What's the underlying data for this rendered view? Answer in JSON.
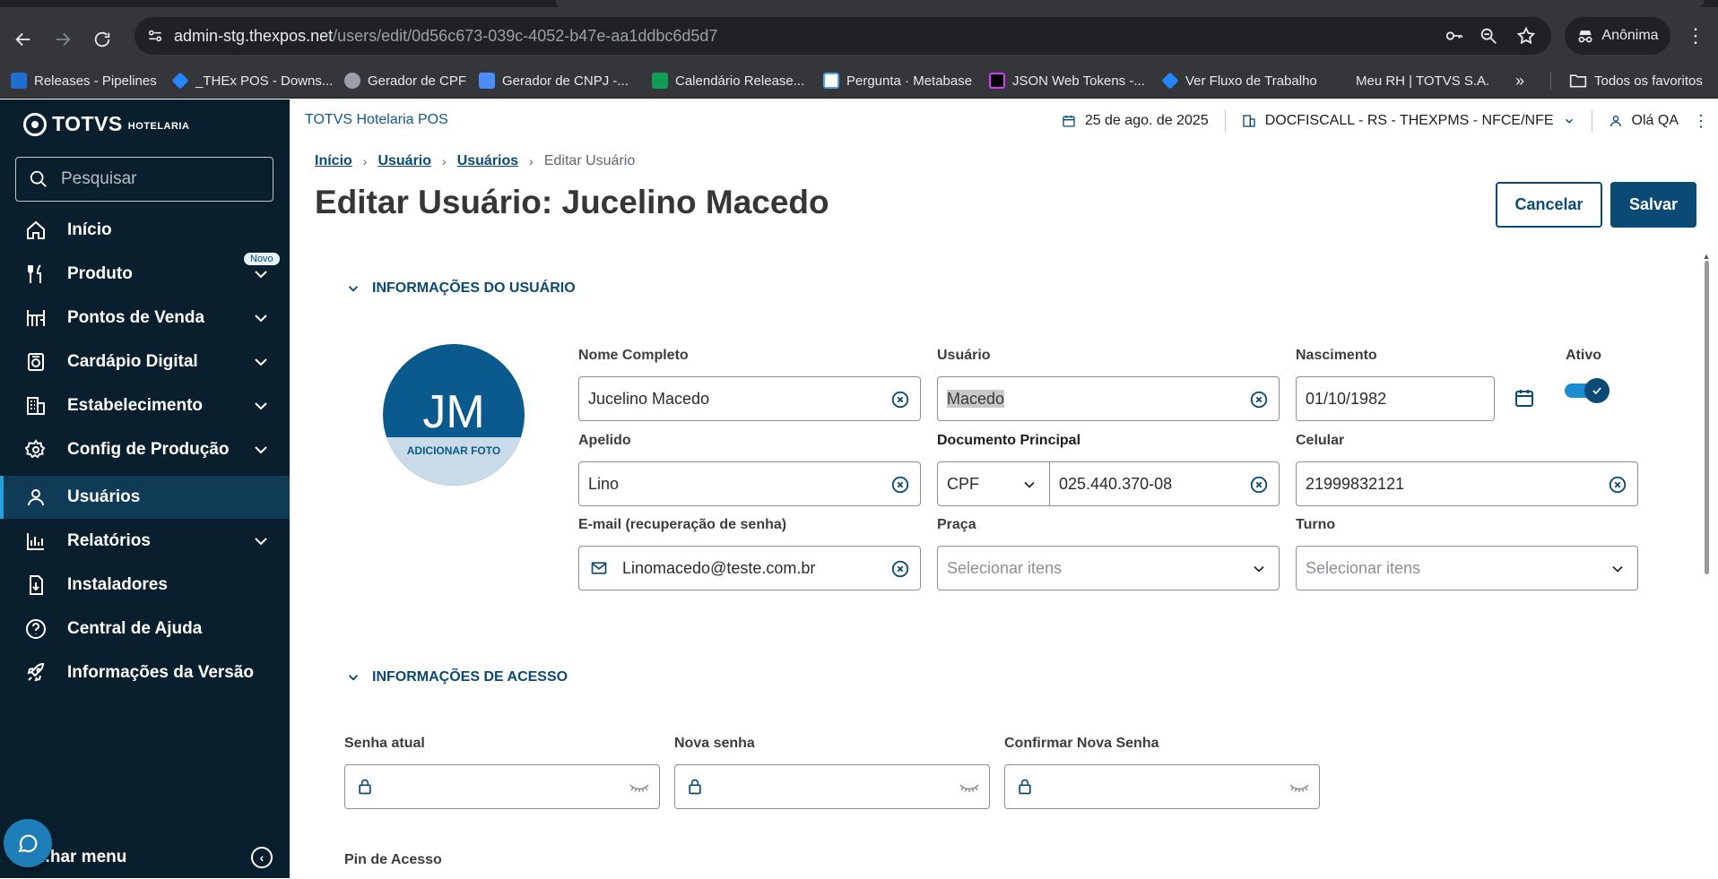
{
  "browser": {
    "url_host": "admin-stg.thexpos.net",
    "url_path": "/users/edit/0d56c673-039c-4052-b47e-aa1ddbc6d5d7",
    "profile_label": "Anônima",
    "bookmarks": [
      {
        "label": "Releases - Pipelines",
        "color": "#1f6fd1"
      },
      {
        "label": "_THEx POS - Downs...",
        "color": "#2684ff"
      },
      {
        "label": "Gerador de CPF",
        "color": "#9aa0a6"
      },
      {
        "label": "Gerador de CNPJ -...",
        "color": "#4b8df8"
      },
      {
        "label": "Calendário Release...",
        "color": "#0f9d58"
      },
      {
        "label": "Pergunta · Metabase",
        "color": "#509ee3"
      },
      {
        "label": "JSON Web Tokens -...",
        "color": "#d63aff"
      },
      {
        "label": "Ver Fluxo de Trabalho",
        "color": "#2684ff"
      },
      {
        "label": "Meu RH | TOTVS S.A.",
        "color": "#35363a"
      }
    ],
    "bookmarks_overflow": "»",
    "all_bookmarks_label": "Todos os favoritos"
  },
  "sidebar": {
    "brand": "TOTVS",
    "brand_sub": "HOTELARIA",
    "search_placeholder": "Pesquisar",
    "novo_badge": "Novo",
    "items": [
      {
        "label": "Início",
        "icon": "home-icon",
        "has_submenu": false
      },
      {
        "label": "Produto",
        "icon": "cutlery-icon",
        "has_submenu": true
      },
      {
        "label": "Pontos de Venda",
        "icon": "store-icon",
        "has_submenu": true
      },
      {
        "label": "Cardápio Digital",
        "icon": "digital-menu-icon",
        "has_submenu": true
      },
      {
        "label": "Estabelecimento",
        "icon": "building-icon",
        "has_submenu": true
      },
      {
        "label": "Config de Produção",
        "icon": "gear-icon",
        "has_submenu": true
      },
      {
        "label": "Usuários",
        "icon": "user-icon",
        "has_submenu": false,
        "active": true
      },
      {
        "label": "Relatórios",
        "icon": "chart-icon",
        "has_submenu": true
      },
      {
        "label": "Instaladores",
        "icon": "installer-icon",
        "has_submenu": false
      },
      {
        "label": "Central de Ajuda",
        "icon": "help-icon",
        "has_submenu": false
      },
      {
        "label": "Informações da Versão",
        "icon": "rocket-icon",
        "has_submenu": false
      }
    ],
    "collapse_label": "...har menu"
  },
  "header": {
    "app_name": "TOTVS Hotelaria POS",
    "date": "25 de ago. de 2025",
    "establishment": "DOCFISCALL - RS - THEXPMS - NFCE/NFE",
    "greeting": "Olá QA"
  },
  "breadcrumb": {
    "items": [
      "Início",
      "Usuário",
      "Usuários"
    ],
    "current": "Editar Usuário"
  },
  "page": {
    "title": "Editar Usuário: Jucelino Macedo",
    "cancel_label": "Cancelar",
    "save_label": "Salvar"
  },
  "user_info": {
    "section_title": "INFORMAÇÕES DO USUÁRIO",
    "avatar_initials": "JM",
    "add_photo_label": "ADICIONAR FOTO",
    "full_name_label": "Nome Completo",
    "full_name": "Jucelino Macedo",
    "username_label": "Usuário",
    "username": "Macedo",
    "birth_label": "Nascimento",
    "birth": "01/10/1982",
    "active_label": "Ativo",
    "active": true,
    "nickname_label": "Apelido",
    "nickname": "Lino",
    "document_label": "Documento Principal",
    "document_type": "CPF",
    "document_number": "025.440.370-08",
    "mobile_label": "Celular",
    "mobile": "21999832121",
    "email_label": "E-mail (recuperação de senha)",
    "email": "Linomacedo@teste.com.br",
    "square_label": "Praça",
    "square_placeholder": "Selecionar itens",
    "shift_label": "Turno",
    "shift_placeholder": "Selecionar itens"
  },
  "access_info": {
    "section_title": "INFORMAÇÕES DE ACESSO",
    "current_password_label": "Senha atual",
    "new_password_label": "Nova senha",
    "confirm_password_label": "Confirmar Nova Senha",
    "pin_label": "Pin de Acesso"
  },
  "colors": {
    "sidebar_bg": "#0a1f2e",
    "primary": "#0b4a74",
    "active_item": "#0f3b57"
  }
}
